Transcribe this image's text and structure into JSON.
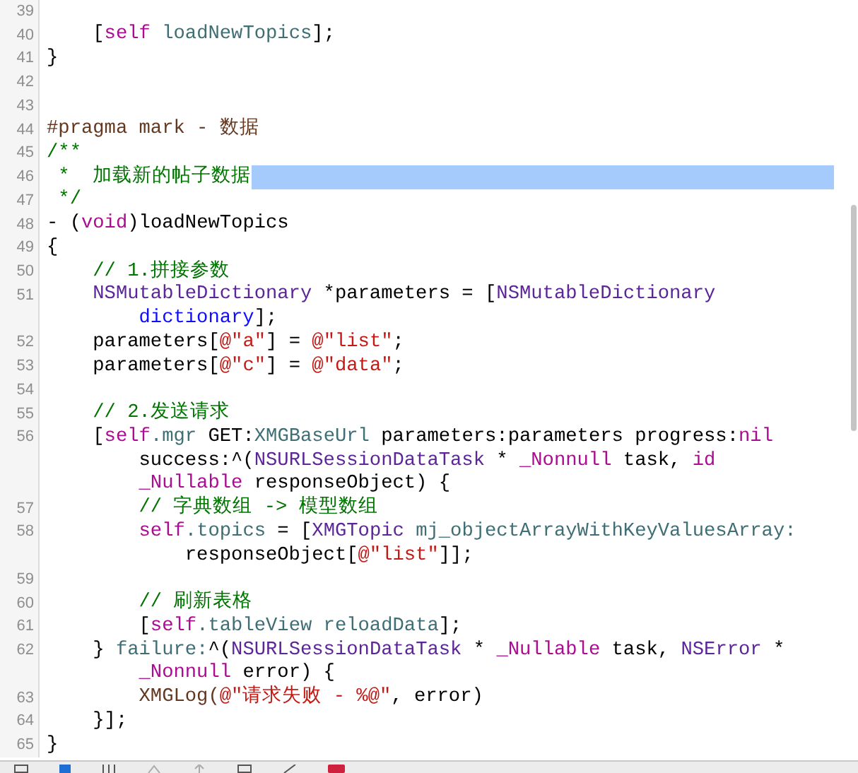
{
  "editor": {
    "lines": [
      {
        "number": "39",
        "selected": false
      },
      {
        "number": "40",
        "selected": false,
        "segments": [
          {
            "text": "    [",
            "color": "#000000"
          },
          {
            "text": "self",
            "color": "#aa0d91"
          },
          {
            "text": " loadNewTopics",
            "color": "#3f6e74"
          },
          {
            "text": "];",
            "color": "#000000"
          }
        ]
      },
      {
        "number": "41",
        "selected": false,
        "segments": [
          {
            "text": "}",
            "color": "#000000"
          }
        ]
      },
      {
        "number": "42",
        "selected": false
      },
      {
        "number": "43",
        "selected": false
      },
      {
        "number": "44",
        "selected": false,
        "segments": [
          {
            "text": "#pragma mark - 数据",
            "color": "#643820"
          }
        ]
      },
      {
        "number": "45",
        "selected": false,
        "segments": [
          {
            "text": "/**",
            "color": "#007400"
          }
        ]
      },
      {
        "number": "46",
        "selected": true,
        "segments": [
          {
            "text": " *  加载新的帖子数据",
            "color": "#007400"
          }
        ]
      },
      {
        "number": "47",
        "selected": false,
        "segments": [
          {
            "text": " */",
            "color": "#007400"
          }
        ]
      },
      {
        "number": "48",
        "selected": false,
        "segments": [
          {
            "text": "- (",
            "color": "#000000"
          },
          {
            "text": "void",
            "color": "#aa0d91"
          },
          {
            "text": ")loadNewTopics",
            "color": "#000000"
          }
        ]
      },
      {
        "number": "49",
        "selected": false,
        "segments": [
          {
            "text": "{",
            "color": "#000000"
          }
        ]
      },
      {
        "number": "50",
        "selected": false,
        "segments": [
          {
            "text": "    // 1.拼接参数",
            "color": "#007400"
          }
        ]
      },
      {
        "number": "51",
        "selected": false,
        "segments": [
          {
            "text": "    NSMutableDictionary",
            "color": "#5c2699"
          },
          {
            "text": " *parameters = [",
            "color": "#000000"
          },
          {
            "text": "NSMutableDictionary",
            "color": "#5c2699"
          }
        ]
      },
      {
        "selected": false,
        "segments": [
          {
            "text": "        dictionary",
            "color": "#0e0eff"
          },
          {
            "text": "];",
            "color": "#000000"
          }
        ]
      },
      {
        "number": "52",
        "selected": false,
        "segments": [
          {
            "text": "    parameters[",
            "color": "#000000"
          },
          {
            "text": "@\"a\"",
            "color": "#c41a16"
          },
          {
            "text": "] = ",
            "color": "#000000"
          },
          {
            "text": "@\"list\"",
            "color": "#c41a16"
          },
          {
            "text": ";",
            "color": "#000000"
          }
        ]
      },
      {
        "number": "53",
        "selected": false,
        "segments": [
          {
            "text": "    parameters[",
            "color": "#000000"
          },
          {
            "text": "@\"c\"",
            "color": "#c41a16"
          },
          {
            "text": "] = ",
            "color": "#000000"
          },
          {
            "text": "@\"data\"",
            "color": "#c41a16"
          },
          {
            "text": ";",
            "color": "#000000"
          }
        ]
      },
      {
        "number": "54",
        "selected": false
      },
      {
        "number": "55",
        "selected": false,
        "segments": [
          {
            "text": "    // 2.发送请求",
            "color": "#007400"
          }
        ]
      },
      {
        "number": "56",
        "selected": false,
        "segments": [
          {
            "text": "    [",
            "color": "#000000"
          },
          {
            "text": "self",
            "color": "#aa0d91"
          },
          {
            "text": ".mgr",
            "color": "#3f6e74"
          },
          {
            "text": " GET:",
            "color": "#000000"
          },
          {
            "text": "XMGBaseUrl",
            "color": "#3f6e74"
          },
          {
            "text": " parameters:parameters progress:",
            "color": "#000000"
          },
          {
            "text": "nil",
            "color": "#aa0d91"
          }
        ]
      },
      {
        "selected": false,
        "segments": [
          {
            "text": "        success:^(",
            "color": "#000000"
          },
          {
            "text": "NSURLSessionDataTask",
            "color": "#5c2699"
          },
          {
            "text": " * ",
            "color": "#000000"
          },
          {
            "text": "_Nonnull",
            "color": "#aa0d91"
          },
          {
            "text": " task, ",
            "color": "#000000"
          },
          {
            "text": "id",
            "color": "#aa0d91"
          }
        ]
      },
      {
        "selected": false,
        "segments": [
          {
            "text": "        _Nullable",
            "color": "#aa0d91"
          },
          {
            "text": " responseObject) {",
            "color": "#000000"
          }
        ]
      },
      {
        "number": "57",
        "selected": false,
        "segments": [
          {
            "text": "        // 字典数组 -> 模型数组",
            "color": "#007400"
          }
        ]
      },
      {
        "number": "58",
        "selected": false,
        "segments": [
          {
            "text": "        self",
            "color": "#aa0d91"
          },
          {
            "text": ".topics",
            "color": "#3f6e74"
          },
          {
            "text": " = [",
            "color": "#000000"
          },
          {
            "text": "XMGTopic",
            "color": "#5c2699"
          },
          {
            "text": " mj_objectArrayWithKeyValuesArray:",
            "color": "#3f6e74"
          }
        ]
      },
      {
        "selected": false,
        "segments": [
          {
            "text": "            responseObject[",
            "color": "#000000"
          },
          {
            "text": "@\"list\"",
            "color": "#c41a16"
          },
          {
            "text": "]];",
            "color": "#000000"
          }
        ]
      },
      {
        "number": "59",
        "selected": false
      },
      {
        "number": "60",
        "selected": false,
        "segments": [
          {
            "text": "        // 刷新表格",
            "color": "#007400"
          }
        ]
      },
      {
        "number": "61",
        "selected": false,
        "segments": [
          {
            "text": "        [",
            "color": "#000000"
          },
          {
            "text": "self",
            "color": "#aa0d91"
          },
          {
            "text": ".tableView reloadData",
            "color": "#3f6e74"
          },
          {
            "text": "];",
            "color": "#000000"
          }
        ]
      },
      {
        "number": "62",
        "selected": false,
        "segments": [
          {
            "text": "    } ",
            "color": "#000000"
          },
          {
            "text": "failure:",
            "color": "#3f6e74"
          },
          {
            "text": "^(",
            "color": "#000000"
          },
          {
            "text": "NSURLSessionDataTask",
            "color": "#5c2699"
          },
          {
            "text": " * ",
            "color": "#000000"
          },
          {
            "text": "_Nullable",
            "color": "#aa0d91"
          },
          {
            "text": " task, ",
            "color": "#000000"
          },
          {
            "text": "NSError",
            "color": "#5c2699"
          },
          {
            "text": " *",
            "color": "#000000"
          }
        ]
      },
      {
        "selected": false,
        "segments": [
          {
            "text": "        _Nonnull",
            "color": "#aa0d91"
          },
          {
            "text": " error) {",
            "color": "#000000"
          }
        ]
      },
      {
        "number": "63",
        "selected": false,
        "segments": [
          {
            "text": "        XMGLog(",
            "color": "#643820"
          },
          {
            "text": "@\"请求失败 - %@\"",
            "color": "#c41a16"
          },
          {
            "text": ", error)",
            "color": "#000000"
          }
        ]
      },
      {
        "number": "64",
        "selected": false,
        "segments": [
          {
            "text": "    }];",
            "color": "#000000"
          }
        ]
      },
      {
        "number": "65",
        "selected": false,
        "segments": [
          {
            "text": "}",
            "color": "#000000"
          }
        ]
      }
    ]
  }
}
